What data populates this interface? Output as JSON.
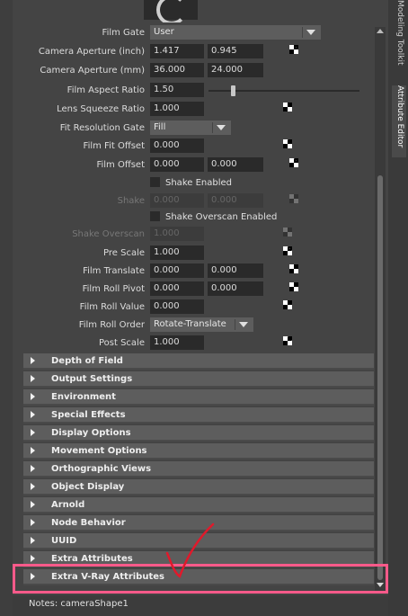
{
  "side_tabs": [
    "Modeling Toolkit",
    "Attribute Editor"
  ],
  "camera": {
    "film_gate": {
      "label": "Film Gate",
      "value": "User"
    },
    "camera_aperture_inch": {
      "label": "Camera Aperture (inch)",
      "v1": "1.417",
      "v2": "0.945"
    },
    "camera_aperture_mm": {
      "label": "Camera Aperture (mm)",
      "v1": "36.000",
      "v2": "24.000"
    },
    "film_aspect_ratio": {
      "label": "Film Aspect Ratio",
      "value": "1.50"
    },
    "lens_squeeze_ratio": {
      "label": "Lens Squeeze Ratio",
      "value": "1.000"
    },
    "fit_resolution_gate": {
      "label": "Fit Resolution Gate",
      "value": "Fill"
    },
    "film_fit_offset": {
      "label": "Film Fit Offset",
      "value": "0.000"
    },
    "film_offset": {
      "label": "Film Offset",
      "v1": "0.000",
      "v2": "0.000"
    },
    "shake_enabled": {
      "label": "Shake Enabled"
    },
    "shake": {
      "label": "Shake",
      "v1": "0.000",
      "v2": "0.000"
    },
    "shake_overscan_enabled": {
      "label": "Shake Overscan Enabled"
    },
    "shake_overscan": {
      "label": "Shake Overscan",
      "value": "1.000"
    },
    "pre_scale": {
      "label": "Pre Scale",
      "value": "1.000"
    },
    "film_translate": {
      "label": "Film Translate",
      "v1": "0.000",
      "v2": "0.000"
    },
    "film_roll_pivot": {
      "label": "Film Roll Pivot",
      "v1": "0.000",
      "v2": "0.000"
    },
    "film_roll_value": {
      "label": "Film Roll Value",
      "value": "0.000"
    },
    "film_roll_order": {
      "label": "Film Roll Order",
      "value": "Rotate-Translate"
    },
    "post_scale": {
      "label": "Post Scale",
      "value": "1.000"
    }
  },
  "sections": [
    "Depth of Field",
    "Output Settings",
    "Environment",
    "Special Effects",
    "Display Options",
    "Movement Options",
    "Orthographic Views",
    "Object Display",
    "Arnold",
    "Node Behavior",
    "UUID",
    "Extra Attributes",
    "Extra V-Ray Attributes"
  ],
  "notes": {
    "text": "Notes:  cameraShape1"
  },
  "colors": {
    "highlight": "#ff5a8a",
    "annotation_check": "#e0192b"
  }
}
